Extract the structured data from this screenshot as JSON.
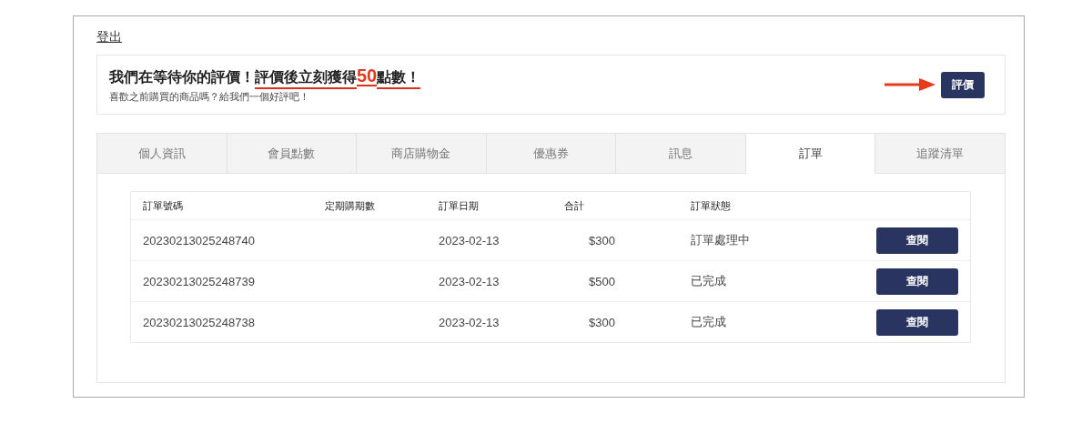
{
  "logout_link": "登出",
  "review_banner": {
    "headline": [
      {
        "kind": "plain",
        "text": "我們在等待你的評價！"
      },
      {
        "kind": "promo",
        "text": "評價後立刻獲得"
      },
      {
        "kind": "number",
        "text": "50"
      },
      {
        "kind": "promo",
        "text": "點數！"
      }
    ],
    "subtitle": "喜歡之前購買的商品嗎？給我們一個好評吧！",
    "button": "評價"
  },
  "tabs": [
    {
      "label": "個人資訊",
      "selected": false
    },
    {
      "label": "會員點數",
      "selected": false
    },
    {
      "label": "商店購物金",
      "selected": false
    },
    {
      "label": "優惠券",
      "selected": false
    },
    {
      "label": "訊息",
      "selected": false
    },
    {
      "label": "訂單",
      "selected": true
    },
    {
      "label": "追蹤清單",
      "selected": false
    }
  ],
  "table": {
    "columns": [
      "訂單號碼",
      "定期購期數",
      "訂單日期",
      "合計",
      "訂單狀態"
    ],
    "rows": [
      {
        "order_number": "20230213025248740",
        "date": "2023-02-13",
        "total": "$300",
        "status": "訂單處理中",
        "action": "查閱"
      },
      {
        "order_number": "20230213025248739",
        "date": "2023-02-13",
        "total": "$500",
        "status": "已完成",
        "action": "查閱"
      },
      {
        "order_number": "20230213025248738",
        "date": "2023-02-13",
        "total": "$300",
        "status": "已完成",
        "action": "查閱"
      }
    ]
  }
}
